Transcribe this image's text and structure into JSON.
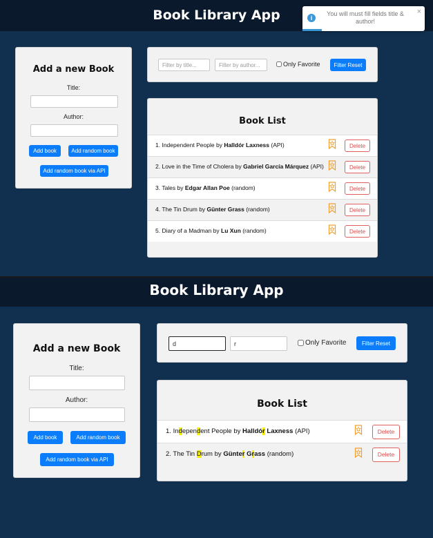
{
  "app": {
    "title": "Book Library App"
  },
  "notification": {
    "icon": "info-icon",
    "message": "You will must fill fields title & author!",
    "close_glyph": "×"
  },
  "form": {
    "heading": "Add a new Book",
    "title_label": "Title:",
    "author_label": "Author:",
    "add_book": "Add book",
    "add_random": "Add random book",
    "add_random_api": "Add random book via API"
  },
  "filters": {
    "title_placeholder": "Filter by title...",
    "author_placeholder": "Filter by author...",
    "only_favorite": "Only Favorite",
    "reset": "Filter Reset"
  },
  "list": {
    "heading": "Book List",
    "delete_label": "Delete",
    "bookmark_icon": "bookmark-icon"
  },
  "screen1": {
    "title_filter": "",
    "author_filter": "",
    "books": [
      {
        "num": "1.",
        "title": "Independent People",
        "by": "by",
        "author": "Halldór Laxness",
        "source": "(API)"
      },
      {
        "num": "2.",
        "title": "Love in the Time of Cholera",
        "by": "by",
        "author": "Gabriel García Márquez",
        "source": "(API)"
      },
      {
        "num": "3.",
        "title": "Tales",
        "by": "by",
        "author": "Edgar Allan Poe",
        "source": "(random)"
      },
      {
        "num": "4.",
        "title": "The Tin Drum",
        "by": "by",
        "author": "Günter Grass",
        "source": "(random)"
      },
      {
        "num": "5.",
        "title": "Diary of a Madman",
        "by": "by",
        "author": "Lu Xun",
        "source": "(random)"
      }
    ]
  },
  "screen2": {
    "title_filter": "d",
    "author_filter": "r",
    "books": [
      {
        "num": "1.",
        "title": "Independent People",
        "by": "by",
        "author": "Halldór Laxness",
        "source": "(API)"
      },
      {
        "num": "2.",
        "title": "The Tin Drum",
        "by": "by",
        "author": "Günter Grass",
        "source": "(random)"
      }
    ]
  },
  "colors": {
    "background": "#11304f",
    "header": "#0a1a2c",
    "primary_button": "#0b7dfa",
    "delete": "#e04848",
    "bookmark": "#f0a030",
    "highlight": "#f7f000",
    "info": "#3b97d6"
  }
}
